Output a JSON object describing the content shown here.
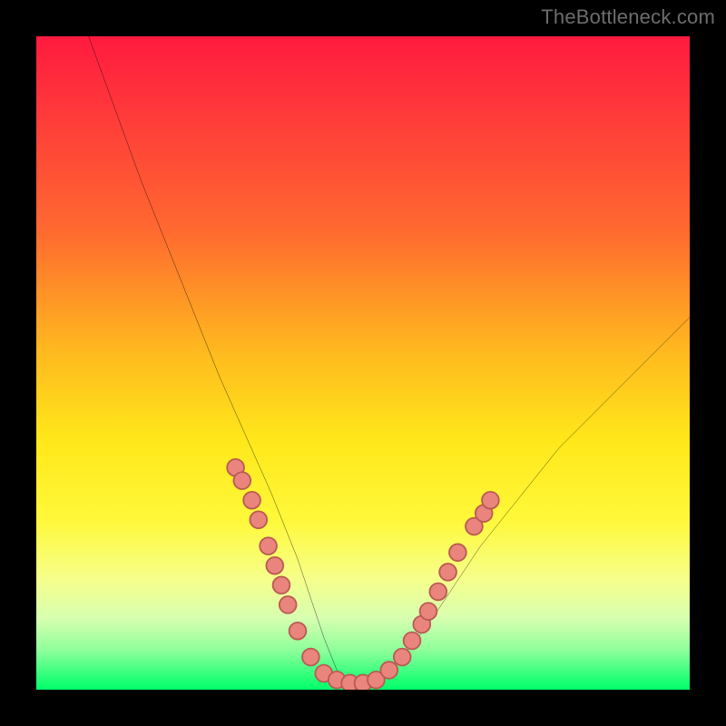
{
  "watermark": "TheBottleneck.com",
  "colors": {
    "background": "#000000",
    "curve": "#000000",
    "marker_fill": "#e9857d",
    "marker_stroke": "#b95a52",
    "gradient_stops": [
      "#ff1a3f",
      "#ff6a2f",
      "#ffe81a",
      "#d8ffb0",
      "#00ff6a"
    ]
  },
  "chart_data": {
    "type": "line",
    "title": "",
    "xlabel": "",
    "ylabel": "",
    "xlim": [
      0,
      100
    ],
    "ylim": [
      0,
      100
    ],
    "grid": false,
    "legend": false,
    "description": "V-shaped bottleneck curve. Left branch falls steeply from near 100% at x≈8 to a flat valley near 0% around x≈44–52, then the right branch rises with diminishing slope toward ~58% at x=100. Pink sample markers cluster along both branches between y≈7 and y≈35 and across the flat valley.",
    "series": [
      {
        "name": "bottleneck-curve",
        "x": [
          8,
          12,
          16,
          20,
          24,
          28,
          32,
          36,
          40,
          44,
          46,
          48,
          50,
          52,
          56,
          60,
          64,
          68,
          72,
          76,
          80,
          84,
          88,
          92,
          96,
          100
        ],
        "y": [
          100,
          89,
          78,
          68,
          58,
          48,
          39,
          30,
          20,
          8,
          3,
          1,
          0.8,
          1.5,
          5,
          10,
          16,
          22,
          27,
          32,
          37,
          41,
          45,
          49,
          53,
          57
        ]
      }
    ],
    "markers": [
      {
        "x": 30.5,
        "y": 34
      },
      {
        "x": 31.5,
        "y": 32
      },
      {
        "x": 33.0,
        "y": 29
      },
      {
        "x": 34.0,
        "y": 26
      },
      {
        "x": 35.5,
        "y": 22
      },
      {
        "x": 36.5,
        "y": 19
      },
      {
        "x": 37.5,
        "y": 16
      },
      {
        "x": 38.5,
        "y": 13
      },
      {
        "x": 40.0,
        "y": 9
      },
      {
        "x": 42.0,
        "y": 5
      },
      {
        "x": 44.0,
        "y": 2.5
      },
      {
        "x": 46.0,
        "y": 1.5
      },
      {
        "x": 48.0,
        "y": 1.0
      },
      {
        "x": 50.0,
        "y": 1.0
      },
      {
        "x": 52.0,
        "y": 1.5
      },
      {
        "x": 54.0,
        "y": 3.0
      },
      {
        "x": 56.0,
        "y": 5.0
      },
      {
        "x": 57.5,
        "y": 7.5
      },
      {
        "x": 59.0,
        "y": 10.0
      },
      {
        "x": 60.0,
        "y": 12.0
      },
      {
        "x": 61.5,
        "y": 15.0
      },
      {
        "x": 63.0,
        "y": 18.0
      },
      {
        "x": 64.5,
        "y": 21.0
      },
      {
        "x": 67.0,
        "y": 25.0
      },
      {
        "x": 68.5,
        "y": 27.0
      },
      {
        "x": 69.5,
        "y": 29.0
      }
    ]
  }
}
